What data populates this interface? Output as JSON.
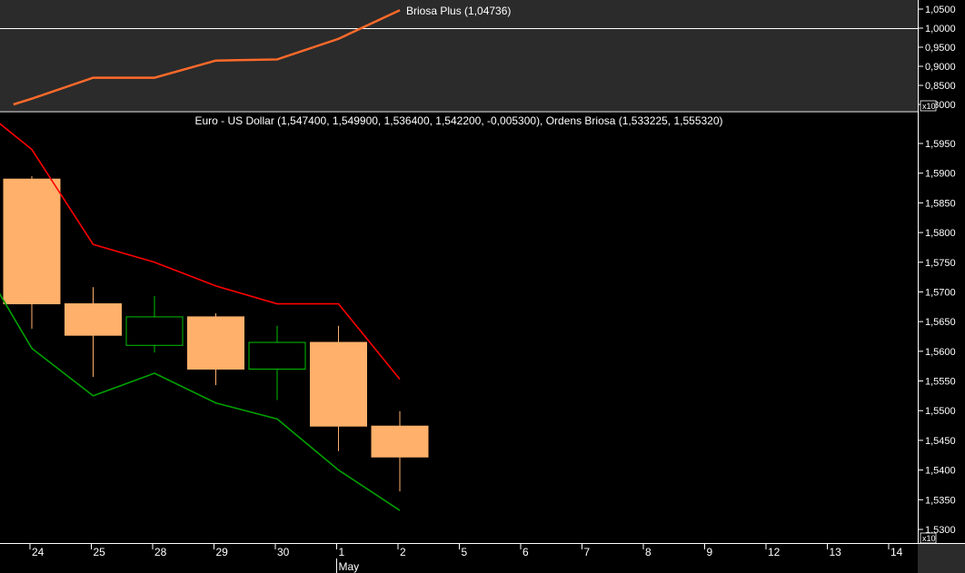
{
  "chart_data": [
    {
      "type": "line",
      "panel": "indicator",
      "title": "Briosa Plus (1,04736)",
      "color": "#ff6a2a",
      "ylim": [
        0.8,
        1.06
      ],
      "y_ticks": [
        "1,0500",
        "1,0000",
        "0,9500",
        "0,9000",
        "0,8500",
        "0,8000"
      ],
      "y_tick_values": [
        1.05,
        1.0,
        0.95,
        0.9,
        0.85,
        0.8
      ],
      "scale_badge": "x10",
      "reference_line": 1.0,
      "x": [
        -0.3,
        0,
        1,
        2,
        3,
        4,
        5,
        6
      ],
      "values": [
        0.8,
        0.815,
        0.87,
        0.87,
        0.915,
        0.918,
        0.972,
        1.047
      ]
    },
    {
      "type": "candlestick",
      "panel": "price",
      "title": "Euro - US Dollar (1,547400, 1,549900, 1,536400, 1,542200, -0,005300), Ordens Briosa (1,533225, 1,555320)",
      "ylim": [
        1.527,
        1.6
      ],
      "y_ticks": [
        "1,5950",
        "1,5900",
        "1,5850",
        "1,5800",
        "1,5750",
        "1,5700",
        "1,5650",
        "1,5600",
        "1,5550",
        "1,5500",
        "1,5450",
        "1,5400",
        "1,5350",
        "1,5300"
      ],
      "y_tick_values": [
        1.595,
        1.59,
        1.585,
        1.58,
        1.575,
        1.57,
        1.565,
        1.56,
        1.555,
        1.55,
        1.545,
        1.54,
        1.535,
        1.53
      ],
      "scale_badge": "x10",
      "candles": [
        {
          "x": 0,
          "open": 1.568,
          "high": 1.5895,
          "low": 1.5638,
          "close": 1.589,
          "color": "#ffb06a"
        },
        {
          "x": 1,
          "open": 1.568,
          "high": 1.5708,
          "low": 1.5557,
          "close": 1.5627,
          "color": "#ffb06a"
        },
        {
          "x": 2,
          "open": 1.561,
          "high": 1.5693,
          "low": 1.5598,
          "close": 1.5658,
          "color": "#00c000"
        },
        {
          "x": 3,
          "open": 1.5658,
          "high": 1.5664,
          "low": 1.5543,
          "close": 1.557,
          "color": "#ffb06a"
        },
        {
          "x": 4,
          "open": 1.557,
          "high": 1.5643,
          "low": 1.5518,
          "close": 1.5615,
          "color": "#00c000"
        },
        {
          "x": 5,
          "open": 1.5615,
          "high": 1.5643,
          "low": 1.5432,
          "close": 1.5474,
          "color": "#ffb06a"
        },
        {
          "x": 6,
          "open": 1.5474,
          "high": 1.5499,
          "low": 1.5364,
          "close": 1.5422,
          "color": "#ffb06a"
        }
      ],
      "series": [
        {
          "name": "Ordens Briosa upper",
          "color": "#ff0000",
          "x": [
            -0.6,
            0,
            1,
            2,
            3,
            4,
            5,
            6
          ],
          "values": [
            1.599,
            1.594,
            1.578,
            1.575,
            1.571,
            1.568,
            1.568,
            1.5553
          ]
        },
        {
          "name": "Ordens Briosa lower",
          "color": "#00a000",
          "x": [
            -0.6,
            0,
            1,
            2,
            3,
            4,
            5,
            6
          ],
          "values": [
            1.571,
            1.5605,
            1.5525,
            1.5563,
            1.5513,
            1.5486,
            1.54,
            1.5332
          ]
        }
      ]
    }
  ],
  "x_axis": {
    "ticks": [
      {
        "x": 0,
        "label": "24"
      },
      {
        "x": 1,
        "label": "25"
      },
      {
        "x": 2,
        "label": "28"
      },
      {
        "x": 3,
        "label": "29"
      },
      {
        "x": 4,
        "label": "30"
      },
      {
        "x": 5,
        "label": "1"
      },
      {
        "x": 6,
        "label": "2"
      },
      {
        "x": 7,
        "label": "5"
      },
      {
        "x": 8,
        "label": "6"
      },
      {
        "x": 9,
        "label": "7"
      },
      {
        "x": 10,
        "label": "8"
      },
      {
        "x": 11,
        "label": "9"
      },
      {
        "x": 12,
        "label": "12"
      },
      {
        "x": 13,
        "label": "13"
      },
      {
        "x": 14,
        "label": "14"
      }
    ],
    "month_label": "May",
    "month_start_x": 5
  }
}
